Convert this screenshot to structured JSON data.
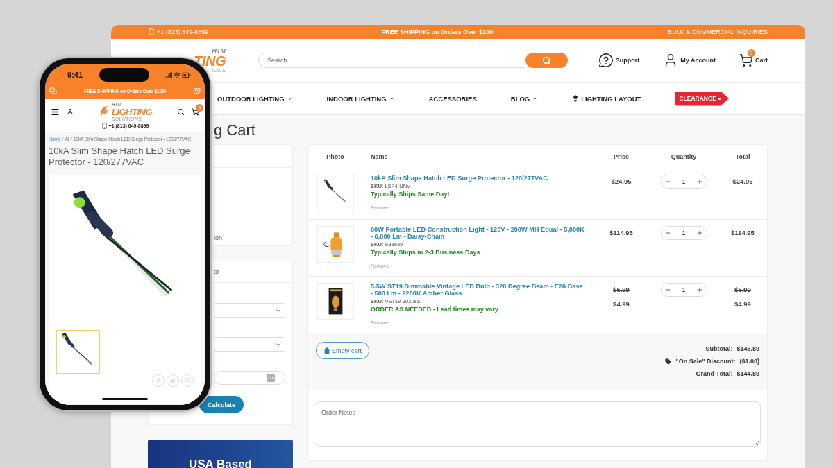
{
  "browser": {
    "top_bar": {
      "phone": "+1 (813) 649-8899",
      "promo": "FREE SHIPPING on Orders Over $100!",
      "link": "BULK & COMMERCIAL INQUIRIES"
    },
    "header": {
      "logo": [
        "HTM",
        "TING",
        "IONS"
      ],
      "search": {
        "placeholder": "Search"
      },
      "actions": [
        {
          "kind": "support",
          "label": "Support"
        },
        {
          "kind": "account",
          "label": "My Account"
        },
        {
          "kind": "cart",
          "label": "Cart",
          "badge": "3"
        }
      ]
    },
    "nav": [
      {
        "kind": "dropdown",
        "label": "OUTDOOR LIGHTING"
      },
      {
        "kind": "dropdown",
        "label": "INDOOR LIGHTING"
      },
      {
        "kind": "plain",
        "label": "ACCESSORIES"
      },
      {
        "kind": "dropdown",
        "label": "BLOG"
      },
      {
        "kind": "icon",
        "label": "LIGHTING LAYOUT"
      },
      {
        "kind": "tag",
        "label": "CLEARANCE"
      }
    ],
    "heading": "g Cart",
    "side_panels": [
      {
        "text": "ion"
      },
      {
        "title": "or",
        "fields": [
          {
            "kind": "select"
          },
          {
            "kind": "select"
          },
          {
            "kind": "input"
          }
        ],
        "button": "Calculate"
      }
    ],
    "banner": "USA Based",
    "cart": {
      "columns": [
        "Photo",
        "Name",
        "Price",
        "Quantity",
        "Total"
      ],
      "items": [
        {
          "name": "10kA Slim Shape Hatch LED Surge Protector - 120/277VAC",
          "sku_label": "SKU:",
          "sku": "LSP4-UNV",
          "note": "Typically Ships Same Day!",
          "remove": "Remove",
          "price": "$24.95",
          "quantity": "1",
          "total": "$24.95"
        },
        {
          "name": "60W Portable LED Construction Light - 120V - 200W MH Equal - 5,000K - 6,000 Lm - Daisy-Chain",
          "sku_label": "SKU:",
          "sku": "S38939",
          "note": "Typically Ships in 2-3 Business Days",
          "remove": "Remove",
          "price": "$114.95",
          "quantity": "1",
          "total": "$114.95"
        },
        {
          "name": "5.5W ST19 Dimmable Vintage LED Bulb - 320 Degree Beam - E26 Base - 500 Lm - 2200K Amber Glass",
          "sku_label": "SKU:",
          "sku": "VST19-3020ea",
          "note": "ORDER AS NEEDED - Lead times may vary",
          "remove": "Remove",
          "old_price": "$5.99",
          "price": "$4.99",
          "quantity": "1",
          "old_total": "$5.99",
          "total": "$4.99"
        }
      ],
      "empty_button": "Empty cart",
      "summary": [
        {
          "kind": "plain",
          "label": "Subtotal:",
          "value": "$145.89"
        },
        {
          "kind": "discount",
          "label": "\"On Sale\" Discount:",
          "value": "($1.00)"
        },
        {
          "kind": "plain",
          "label": "Grand Total:",
          "value": "$144.89"
        }
      ],
      "notes": {
        "placeholder": "Order Notes"
      }
    }
  },
  "phone": {
    "time": "9:41",
    "promo": "FREE SHIPPING on Orders Over $100!",
    "logo": [
      "HTM",
      "LIGHTING",
      "SOLUTIONS"
    ],
    "cart_badge": "3",
    "phone": "+1 (813) 649-8899",
    "breadcrumb": [
      "Home",
      "All",
      "10kA Slim Shape Hatch LED Surge Protector - 120/277VAC"
    ],
    "breadcrumb_separator": "/",
    "title": "10kA Slim Shape Hatch LED Surge Protector - 120/277VAC",
    "thumbnails": [
      {
        "selected": true
      }
    ]
  }
}
